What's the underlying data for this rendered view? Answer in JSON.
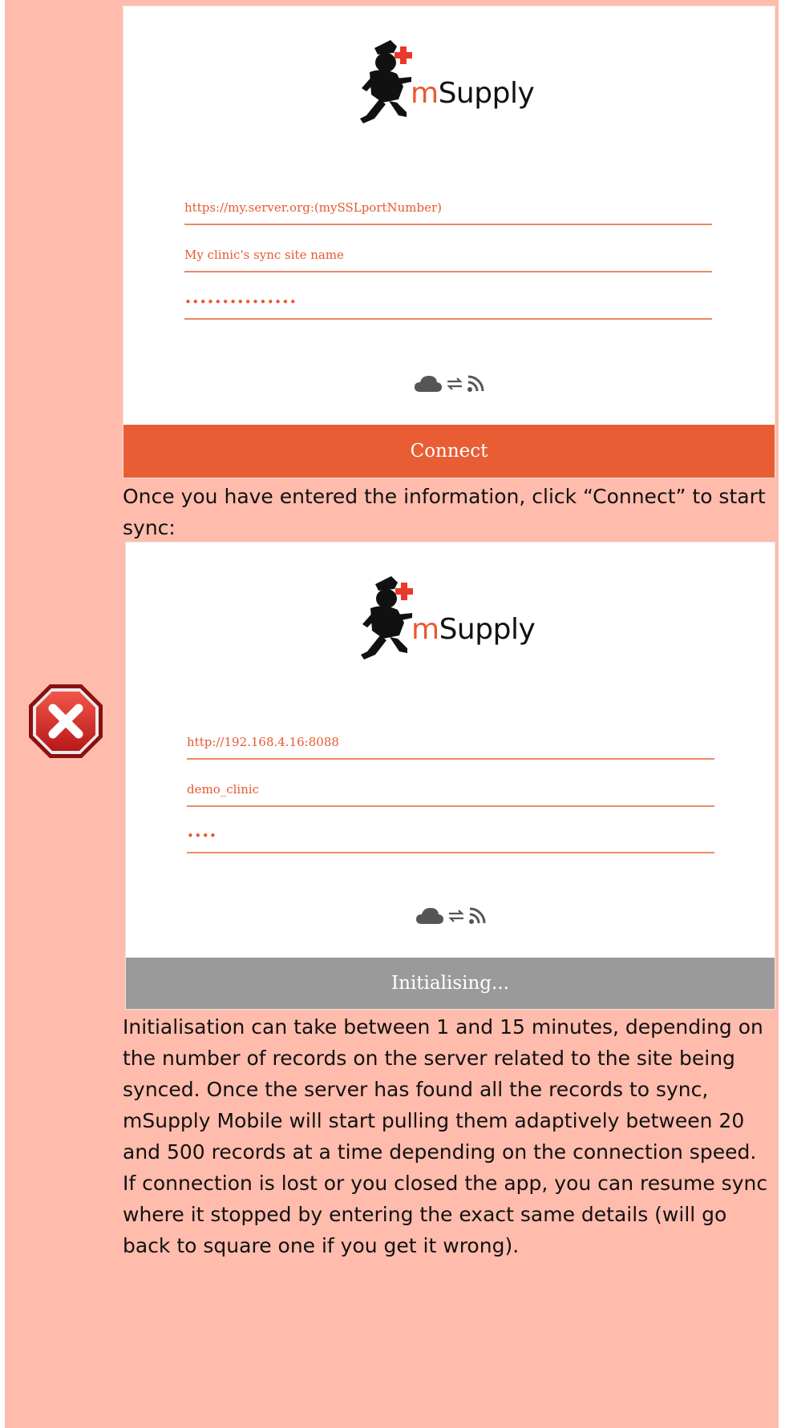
{
  "logo": {
    "brand_prefix": "m",
    "brand_suffix": "Supply"
  },
  "screenshot1": {
    "server_field": "https://my.server.org:(mySSLportNumber)",
    "site_field": "My clinic's sync site name",
    "password_field": "•••••••••••••••",
    "button_label": "Connect"
  },
  "caption1": "Once you have entered the information, click “Connect” to start sync:",
  "screenshot2": {
    "server_field": "http://192.168.4.16:8088",
    "site_field": "demo_clinic",
    "password_field": "••••",
    "status_label": "Initialising..."
  },
  "caption2": "Initialisation can take between 1 and 15 minutes, depending on the number of records on the server related to the site being synced. Once the server has found all the records to sync, mSupply Mobile will start pulling them adaptively between 20 and 500 records at a time depending on the connection speed. If connection is lost or you closed the app, you can resume sync where it stopped by entering the exact same details (will go back to square one if you get it wrong).",
  "colors": {
    "panel_background": "#ffbcad",
    "accent_orange": "#e85d34",
    "initialising_gray": "#9a9a9a",
    "warning_red": "#d02020"
  },
  "icons": [
    "cloud-icon",
    "sync-arrows-icon",
    "wifi-signal-icon",
    "warning-x-icon"
  ]
}
